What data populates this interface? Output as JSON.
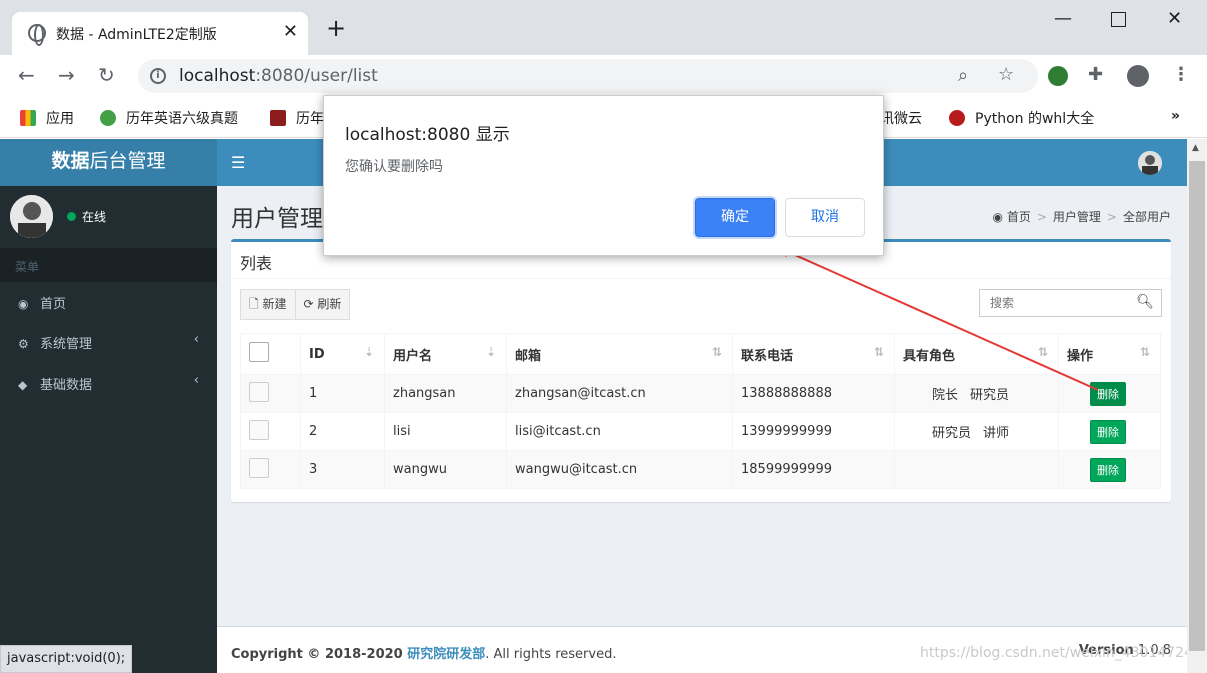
{
  "browser": {
    "tab_title": "数据 - AdminLTE2定制版",
    "url_host": "localhost",
    "url_rest": ":8080/user/list",
    "bookmarks": [
      "应用",
      "历年英语六级真题",
      "历年",
      "讯微云",
      "Python 的whl大全"
    ],
    "status_text": "javascript:void(0);"
  },
  "header": {
    "logo_bold": "数据",
    "logo_rest": "后台管理"
  },
  "sidebar": {
    "status": "在线",
    "menu_header": "菜单",
    "items": [
      {
        "label": "首页"
      },
      {
        "label": "系统管理"
      },
      {
        "label": "基础数据"
      }
    ]
  },
  "content": {
    "title": "用户管理",
    "breadcrumb": [
      "首页",
      "用户管理",
      "全部用户"
    ],
    "box_title": "列表",
    "new_label": "新建",
    "refresh_label": "刷新",
    "search_placeholder": "搜索",
    "columns": [
      "ID",
      "用户名",
      "邮箱",
      "联系电话",
      "具有角色",
      "操作"
    ],
    "rows": [
      {
        "id": "1",
        "username": "zhangsan",
        "email": "zhangsan@itcast.cn",
        "phone": "13888888888",
        "roles": [
          "院长",
          "研究员"
        ],
        "action": "删除"
      },
      {
        "id": "2",
        "username": "lisi",
        "email": "lisi@itcast.cn",
        "phone": "13999999999",
        "roles": [
          "研究员",
          "讲师"
        ],
        "action": "删除"
      },
      {
        "id": "3",
        "username": "wangwu",
        "email": "wangwu@itcast.cn",
        "phone": "18599999999",
        "roles": [],
        "action": "删除"
      }
    ]
  },
  "footer": {
    "copyright": "Copyright © 2018-2020 ",
    "org": "研究院研发部",
    "rights": ". All rights reserved.",
    "version_label": "Version",
    "version": "1.0.8",
    "watermark": "https://blog.csdn.net/weixin_43014724"
  },
  "dialog": {
    "title": "localhost:8080 显示",
    "message": "您确认要删除吗",
    "ok": "确定",
    "cancel": "取消"
  },
  "colors": {
    "accent": "#3c8dbc",
    "sidebar": "#222d32",
    "delete_btn": "#00a65a",
    "dialog_ok": "#3b82f6",
    "arrow": "#e53935"
  }
}
